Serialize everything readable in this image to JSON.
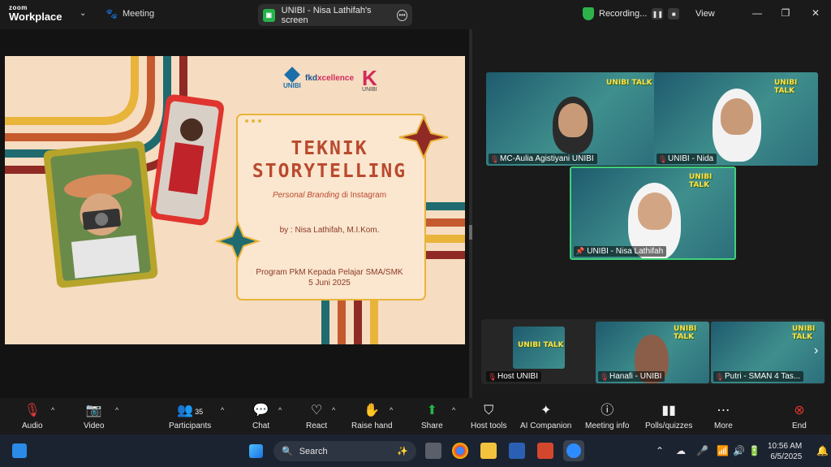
{
  "app": {
    "brand_top": "zoom",
    "brand_bottom": "Workplace",
    "meeting_label": "Meeting"
  },
  "share": {
    "label": "UNIBI - Nisa Lathifah's screen"
  },
  "recording": {
    "label": "Recording..."
  },
  "view": {
    "label": "View"
  },
  "slide": {
    "title_line1": "TEKNIK",
    "title_line2": "STORYTELLING",
    "subtitle_italic": "Personal Branding",
    "subtitle_rest": " di Instagram",
    "author": "by : Nisa Lathifah, M.I.Kom.",
    "program_line1": "Program PkM Kepada Pelajar SMA/SMK",
    "program_line2": "5 Juni 2025",
    "logo_unibi": "UNIBI",
    "logo_fkd_a": "fkd",
    "logo_fkd_b": "xcellence",
    "logo_k": "UNIBI"
  },
  "participants": {
    "aulia": "MC-Aulia Agistiyani UNIBI",
    "nida": "UNIBI - Nida",
    "nisa": "UNIBI - Nisa Lathifah",
    "host": "Host UNIBI",
    "hanafi": "Hanafi - UNIBI",
    "putri": "Putri - SMAN 4 Tas...",
    "talk_logo": "UNIBI TALK"
  },
  "toolbar": {
    "audio": "Audio",
    "video": "Video",
    "participants": "Participants",
    "participants_count": "35",
    "chat": "Chat",
    "react": "React",
    "raise_hand": "Raise hand",
    "share": "Share",
    "host_tools": "Host tools",
    "ai_companion": "AI Companion",
    "meeting_info": "Meeting info",
    "polls": "Polls/quizzes",
    "more": "More",
    "end": "End"
  },
  "taskbar": {
    "search_placeholder": "Search",
    "time": "10:56 AM",
    "date": "6/5/2025"
  },
  "colors": {
    "accent_green": "#26b24b",
    "end_red": "#e0342f",
    "speaker_border": "#3fd17a"
  }
}
